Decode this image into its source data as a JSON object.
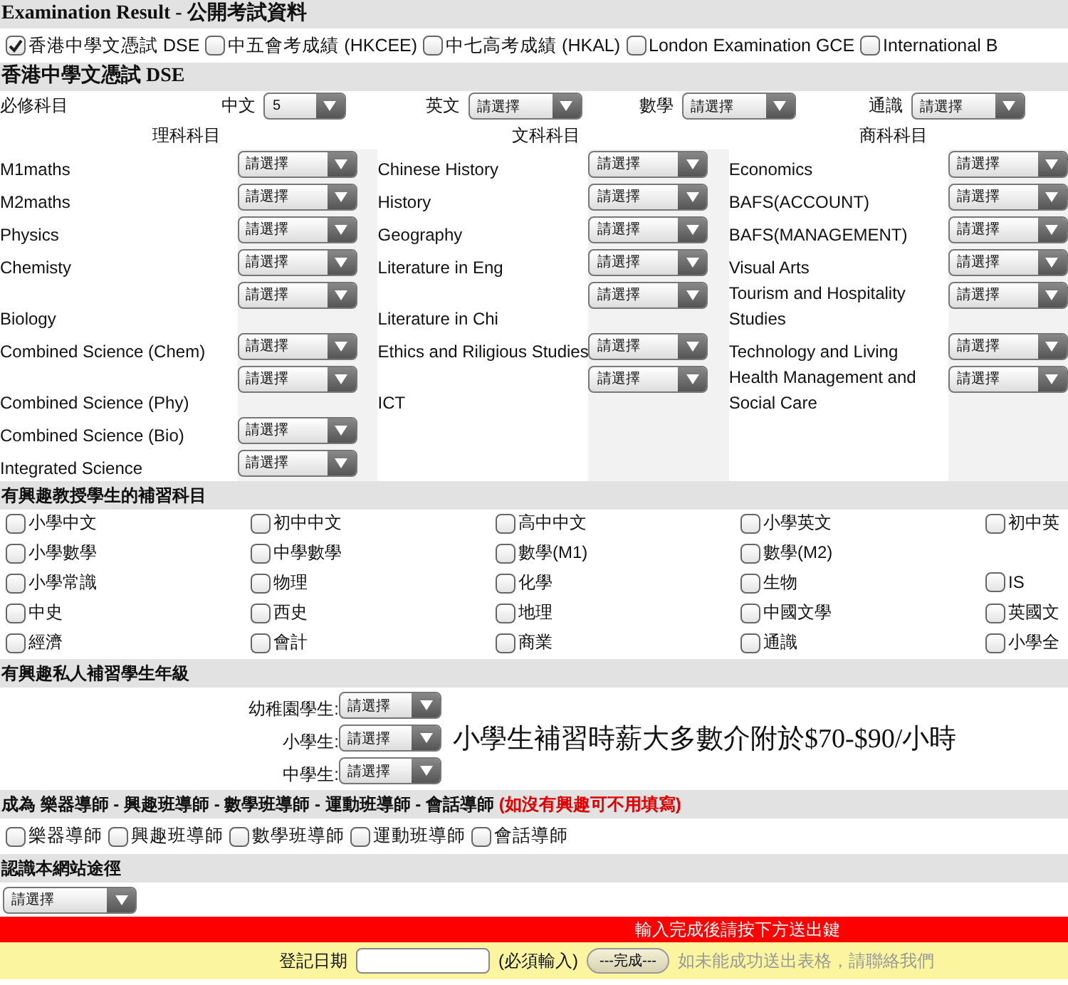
{
  "exam_section": {
    "title": "Examination Result - 公開考試資料",
    "exam_types": [
      {
        "label": "香港中學文憑試 DSE",
        "checked": true
      },
      {
        "label": "中五會考成績 (HKCEE)",
        "checked": false
      },
      {
        "label": "中七高考成績 (HKAL)",
        "checked": false
      },
      {
        "label": "London Examination GCE",
        "checked": false
      },
      {
        "label": "International B",
        "checked": false
      }
    ]
  },
  "dse_section": {
    "title": "香港中學文憑試 DSE",
    "compulsory_label": "必修科目",
    "compulsory": [
      {
        "subject": "中文",
        "value": "5"
      },
      {
        "subject": "英文",
        "value": "請選擇"
      },
      {
        "subject": "數學",
        "value": "請選擇"
      },
      {
        "subject": "通識",
        "value": "請選擇"
      }
    ],
    "groups": [
      {
        "heading": "理科科目",
        "subjects": [
          {
            "name": "M1maths",
            "value": "請選擇"
          },
          {
            "name": "M2maths",
            "value": "請選擇"
          },
          {
            "name": "Physics",
            "value": "請選擇"
          },
          {
            "name": "Chemisty",
            "value": "請選擇"
          },
          {
            "name": "Biology",
            "value": "請選擇"
          },
          {
            "name": "Combined Science (Chem)",
            "value": "請選擇"
          },
          {
            "name": "Combined Science (Phy)",
            "value": "請選擇"
          },
          {
            "name": "Combined Science (Bio)",
            "value": "請選擇"
          },
          {
            "name": "Integrated Science",
            "value": "請選擇"
          }
        ]
      },
      {
        "heading": "文科科目",
        "subjects": [
          {
            "name": "Chinese History",
            "value": "請選擇"
          },
          {
            "name": "History",
            "value": "請選擇"
          },
          {
            "name": "Geography",
            "value": "請選擇"
          },
          {
            "name": "Literature in Eng",
            "value": "請選擇"
          },
          {
            "name": "Literature in Chi",
            "value": "請選擇"
          },
          {
            "name": "Ethics and Riligious Studies",
            "value": "請選擇"
          },
          {
            "name": "ICT",
            "value": "請選擇"
          }
        ]
      },
      {
        "heading": "商科科目",
        "subjects": [
          {
            "name": "Economics",
            "value": "請選擇"
          },
          {
            "name": "BAFS(ACCOUNT)",
            "value": "請選擇"
          },
          {
            "name": "BAFS(MANAGEMENT)",
            "value": "請選擇"
          },
          {
            "name": "Visual Arts",
            "value": "請選擇"
          },
          {
            "name": "Tourism and Hospitality Studies",
            "value": "請選擇"
          },
          {
            "name": "Technology and Living",
            "value": "請選擇"
          },
          {
            "name": "Health Management and Social Care",
            "value": "請選擇"
          }
        ]
      }
    ]
  },
  "tutoring_subjects": {
    "title": "有興趣教授學生的補習科目",
    "rows": [
      [
        {
          "label": "小學中文",
          "checked": false
        },
        {
          "label": "初中中文",
          "checked": false
        },
        {
          "label": "高中中文",
          "checked": false
        },
        {
          "label": "小學英文",
          "checked": false
        },
        {
          "label": "初中英",
          "checked": false
        }
      ],
      [
        {
          "label": "小學數學",
          "checked": false
        },
        {
          "label": "中學數學",
          "checked": false
        },
        {
          "label": "數學(M1)",
          "checked": false
        },
        {
          "label": "數學(M2)",
          "checked": false
        }
      ],
      [
        {
          "label": "小學常識",
          "checked": false
        },
        {
          "label": "物理",
          "checked": false
        },
        {
          "label": "化學",
          "checked": false
        },
        {
          "label": "生物",
          "checked": false
        },
        {
          "label": "IS",
          "checked": false
        }
      ],
      [
        {
          "label": "中史",
          "checked": false
        },
        {
          "label": "西史",
          "checked": false
        },
        {
          "label": "地理",
          "checked": false
        },
        {
          "label": "中國文學",
          "checked": false
        },
        {
          "label": "英國文",
          "checked": false
        }
      ],
      [
        {
          "label": "經濟",
          "checked": false
        },
        {
          "label": "會計",
          "checked": false
        },
        {
          "label": "商業",
          "checked": false
        },
        {
          "label": "通識",
          "checked": false
        },
        {
          "label": "小學全",
          "checked": false
        }
      ]
    ]
  },
  "grade_levels": {
    "title": "有興趣私人補習學生年級",
    "levels": [
      {
        "label": "幼稚園學生:",
        "value": "請選擇"
      },
      {
        "label": "小學生:",
        "value": "請選擇"
      },
      {
        "label": "中學生:",
        "value": "請選擇"
      }
    ],
    "note": "小學生補習時薪大多數介附於$70-$90/小時"
  },
  "tutor_types": {
    "title": "成為 樂器導師 - 興趣班導師 - 數學班導師 - 運動班導師 - 會話導師",
    "note": "(如沒有興趣可不用填寫)",
    "options": [
      {
        "label": "樂器導師",
        "checked": false
      },
      {
        "label": "興趣班導師",
        "checked": false
      },
      {
        "label": "數學班導師",
        "checked": false
      },
      {
        "label": "運動班導師",
        "checked": false
      },
      {
        "label": "會話導師",
        "checked": false
      }
    ]
  },
  "referral": {
    "title": "認識本網站途徑",
    "value": "請選擇"
  },
  "submit_bar": {
    "notice": "輸入完成後請按下方送出鍵",
    "date_label": "登記日期",
    "required_note": "(必須輸入)",
    "button": "---完成---",
    "help_text": "如未能成功送出表格，請聯絡我們"
  }
}
